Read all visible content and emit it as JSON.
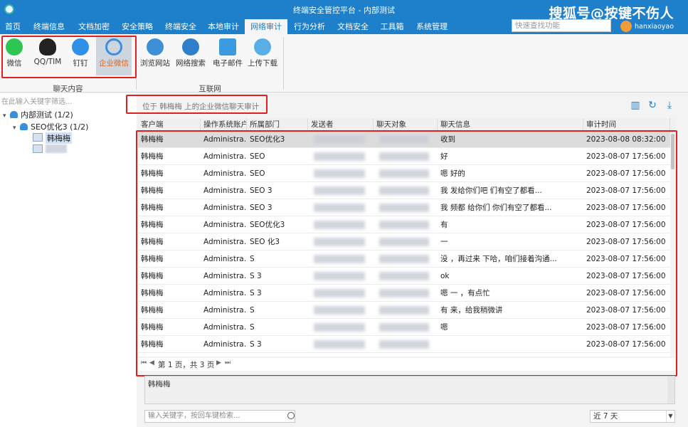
{
  "window": {
    "title": "终端安全管控平台 - 内部测试",
    "watermark": "搜狐号@按键不伤人"
  },
  "menu": {
    "items": [
      "首页",
      "终端信息",
      "文档加密",
      "安全策略",
      "终端安全",
      "本地审计",
      "网络审计",
      "行为分析",
      "文档安全",
      "工具箱",
      "系统管理"
    ],
    "active": "网络审计",
    "quick_search_placeholder": "快速查找功能",
    "user": "hanxiaoyao"
  },
  "ribbon": {
    "chat_group_label": "聊天内容",
    "internet_group_label": "互联网",
    "chat_buttons": [
      "微信",
      "QQ/TIM",
      "钉钉",
      "企业微信"
    ],
    "selected_chat": "企业微信",
    "internet_buttons": [
      "浏览网站",
      "网络搜索",
      "电子邮件",
      "上传下载"
    ]
  },
  "left": {
    "filter_placeholder": "在此输入关键字筛选...",
    "tree": [
      {
        "label": "内部测试 (1/2)"
      },
      {
        "label": "SEO优化3 (1/2)"
      },
      {
        "label": "韩梅梅"
      }
    ]
  },
  "main": {
    "breadcrumb": "位于 韩梅梅 上的企业微信聊天审计",
    "columns": [
      "客户端",
      "操作系统账户",
      "所属部门",
      "发送者",
      "聊天对象",
      "聊天信息",
      "审计时间"
    ],
    "rows": [
      {
        "client": "韩梅梅",
        "account": "Administra...",
        "dept": "SEO优化3",
        "message": "收到",
        "time": "2023-08-08 08:32:00"
      },
      {
        "client": "韩梅梅",
        "account": "Administra...",
        "dept": "SEO",
        "message": "好",
        "time": "2023-08-07 17:56:00"
      },
      {
        "client": "韩梅梅",
        "account": "Administra...",
        "dept": "SEO",
        "message": "嗯 好的",
        "time": "2023-08-07 17:56:00"
      },
      {
        "client": "韩梅梅",
        "account": "Administra...",
        "dept": "SEO 3",
        "message": "我 发给你们吧 们有空了都看...",
        "time": "2023-08-07 17:56:00"
      },
      {
        "client": "韩梅梅",
        "account": "Administra...",
        "dept": "SEO 3",
        "message": "我 频都 给你们 你们有空了都看...",
        "time": "2023-08-07 17:56:00"
      },
      {
        "client": "韩梅梅",
        "account": "Administra...",
        "dept": "SEO优化3",
        "message": "有",
        "time": "2023-08-07 17:56:00"
      },
      {
        "client": "韩梅梅",
        "account": "Administra...",
        "dept": "SEO 化3",
        "message": "一",
        "time": "2023-08-07 17:56:00"
      },
      {
        "client": "韩梅梅",
        "account": "Administra...",
        "dept": "S",
        "message": "没 ，再过来 下哈，咱们接着沟通...",
        "time": "2023-08-07 17:56:00"
      },
      {
        "client": "韩梅梅",
        "account": "Administra...",
        "dept": "S 3",
        "message": "ok",
        "time": "2023-08-07 17:56:00"
      },
      {
        "client": "韩梅梅",
        "account": "Administra...",
        "dept": "S 3",
        "message": "嗯 一 ，有点忙",
        "time": "2023-08-07 17:56:00"
      },
      {
        "client": "韩梅梅",
        "account": "Administra...",
        "dept": "S",
        "message": "有 来，给我稍微讲",
        "time": "2023-08-07 17:56:00"
      },
      {
        "client": "韩梅梅",
        "account": "Administra...",
        "dept": "S",
        "message": "嗯",
        "time": "2023-08-07 17:56:00"
      },
      {
        "client": "韩梅梅",
        "account": "Administra...",
        "dept": "S 3",
        "message": "",
        "time": "2023-08-07 17:56:00"
      }
    ],
    "pager": "第 1 页，共 3 页",
    "detail_text": "韩梅梅",
    "keyword_placeholder": "输入关键字，按回车键检索...",
    "range_value": "近 7 天"
  },
  "colors": {
    "titlebar": "#1e7fcb",
    "highlight_red": "#e02020",
    "selected_label": "#e0661f"
  }
}
